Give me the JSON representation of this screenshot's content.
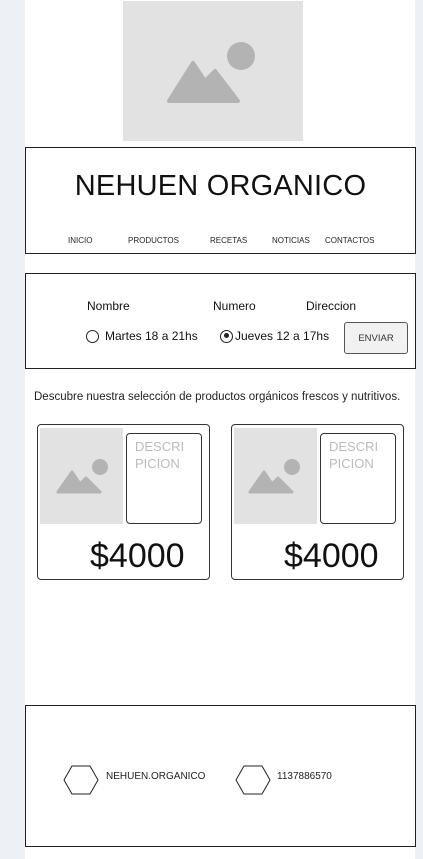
{
  "header": {
    "title": "NEHUEN ORGANICO",
    "nav": [
      "INICIO",
      "PRODUCTOS",
      "RECETAS",
      "NOTICIAS",
      "CONTACTOS"
    ]
  },
  "form": {
    "labels": {
      "name": "Nombre",
      "number": "Numero",
      "address": "Direccion"
    },
    "options": [
      {
        "label": "Martes 18 a 21hs",
        "checked": false
      },
      {
        "label": "Jueves 12 a 17hs",
        "checked": true
      }
    ],
    "submit_label": "ENVIAR"
  },
  "products": {
    "intro": "Descubre nuestra selección de productos orgánicos frescos y nutritivos.",
    "items": [
      {
        "description": "DESCRI PICION",
        "price": "$4000"
      },
      {
        "description": "DESCRI PICION",
        "price": "$4000"
      }
    ]
  },
  "footer": {
    "instagram": "NEHUEN.ORGANICO",
    "phone": "1137886570"
  },
  "icons": {
    "placeholder_image": "image-placeholder-icon",
    "social": "hexagon-icon"
  },
  "colors": {
    "background": "#edf0f5",
    "placeholder": "#e2e2e2",
    "placeholder_shape": "#b3b3b3"
  }
}
